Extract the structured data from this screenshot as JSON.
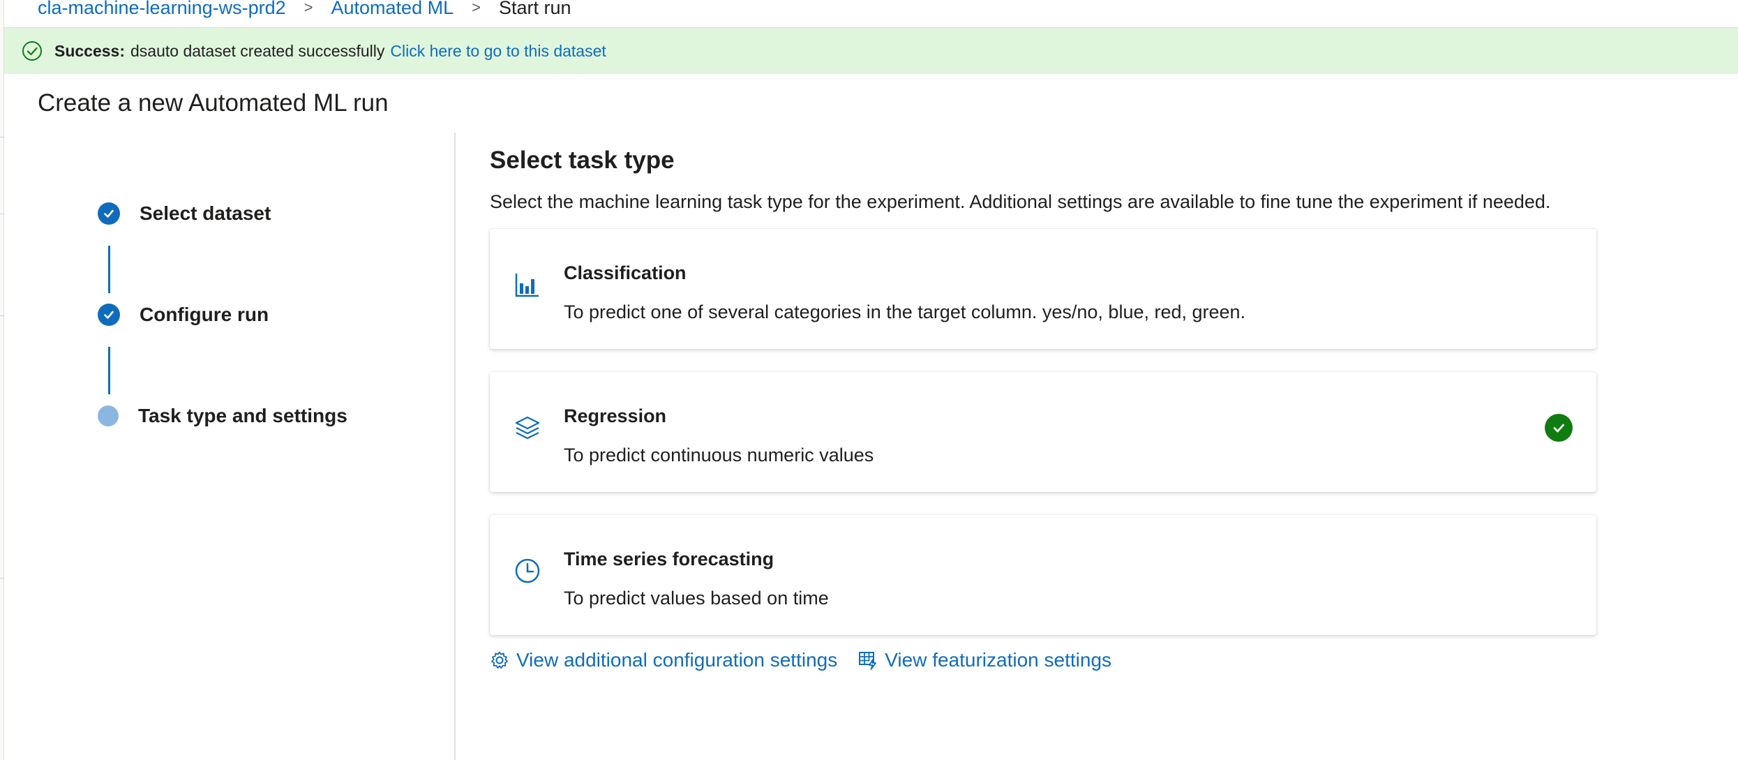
{
  "breadcrumb": {
    "workspace": "cla-machine-learning-ws-prd2",
    "section": "Automated ML",
    "current": "Start run",
    "separator": ">"
  },
  "notification": {
    "status": "Success:",
    "message": "dsauto dataset created successfully",
    "link": "Click here to go to this dataset",
    "color": "#dff6dd",
    "icon": "success-circle-check-icon"
  },
  "page_title": "Create a new Automated ML run",
  "wizard": {
    "steps": [
      {
        "label": "Select dataset",
        "state": "completed",
        "icon": "check-circle-icon"
      },
      {
        "label": "Configure run",
        "state": "completed",
        "icon": "check-circle-icon"
      },
      {
        "label": "Task type and settings",
        "state": "current",
        "icon": "dot-icon"
      }
    ]
  },
  "task_section": {
    "title": "Select task type",
    "description": "Select the machine learning task type for the experiment. Additional settings are available to fine tune the experiment if needed.",
    "tasks": [
      {
        "name": "Classification",
        "description": "To predict one of several categories in the target column. yes/no, blue, red, green.",
        "icon": "bar-chart-icon",
        "selected": false
      },
      {
        "name": "Regression",
        "description": "To predict continuous numeric values",
        "icon": "layers-icon",
        "selected": true
      },
      {
        "name": "Time series forecasting",
        "description": "To predict values based on time",
        "icon": "clock-icon",
        "selected": false
      }
    ]
  },
  "links": {
    "additional_config": "View additional configuration settings",
    "featurization": "View featurization settings"
  },
  "colors": {
    "accent": "#0f6cbd",
    "success_green": "#107c10",
    "success_bg": "#dff6dd",
    "current_step": "#8bb6e2"
  }
}
